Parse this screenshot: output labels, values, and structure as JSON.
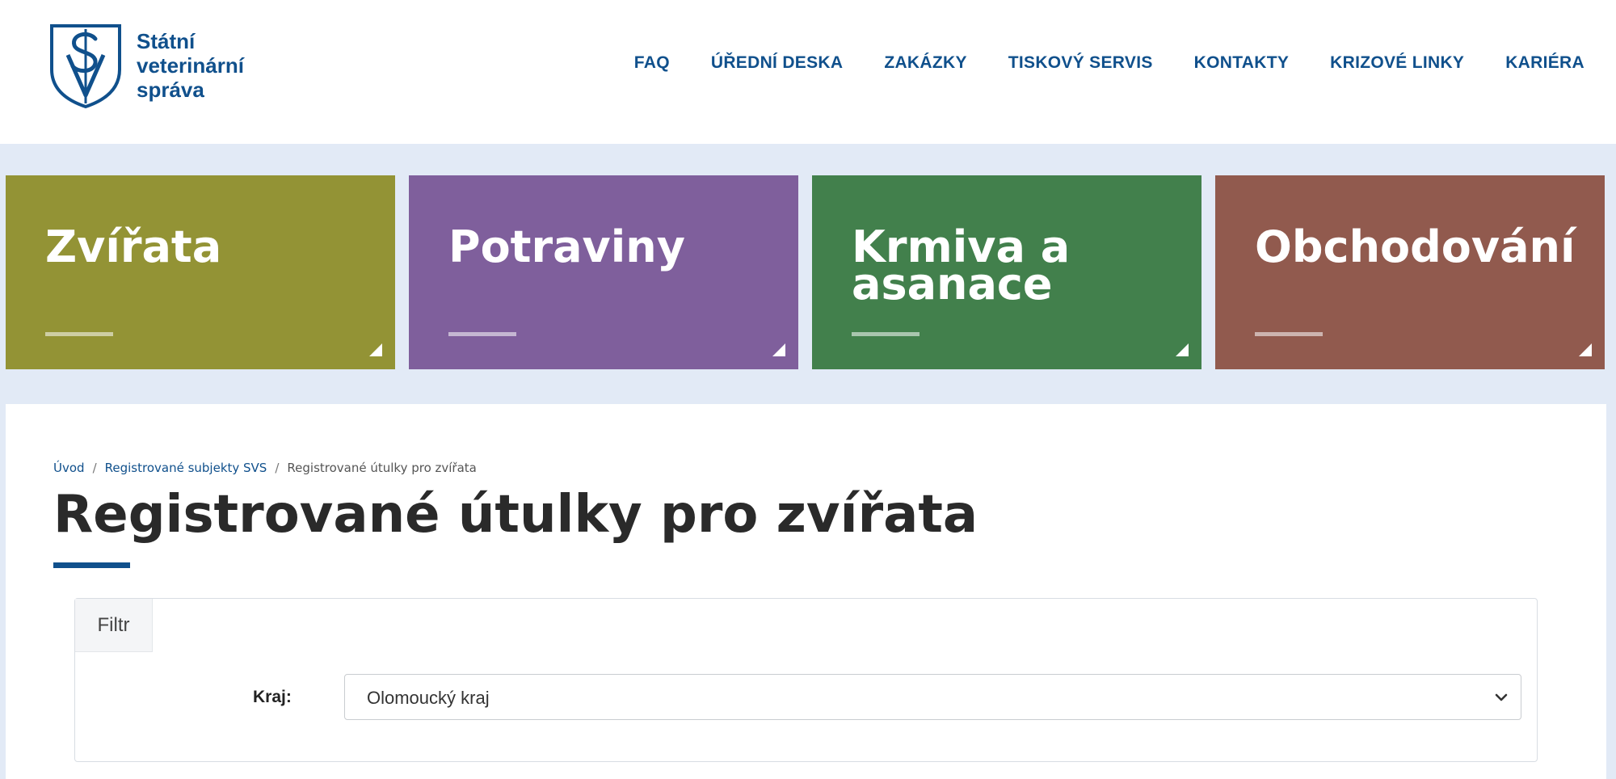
{
  "logo": {
    "line1": "Státní",
    "line2": "veterinární",
    "line3": "správa"
  },
  "topnav": [
    {
      "label": "FAQ"
    },
    {
      "label": "ÚŘEDNÍ DESKA"
    },
    {
      "label": "ZAKÁZKY"
    },
    {
      "label": "TISKOVÝ SERVIS"
    },
    {
      "label": "KONTAKTY"
    },
    {
      "label": "KRIZOVÉ LINKY"
    },
    {
      "label": "KARIÉRA"
    }
  ],
  "tiles": [
    {
      "title": "Zvířata",
      "color": "#939335"
    },
    {
      "title": "Potraviny",
      "color": "#7f5f9c"
    },
    {
      "title": "Krmiva a\nasanace",
      "color": "#42804c"
    },
    {
      "title": "Obchodování",
      "color": "#915a4e"
    }
  ],
  "breadcrumb": {
    "home": "Úvod",
    "parent": "Registrované subjekty SVS",
    "current": "Registrované útulky pro zvířata"
  },
  "page_title": "Registrované útulky pro zvířata",
  "filter": {
    "tab_label": "Filtr",
    "region_label": "Kraj:",
    "region_value": "Olomoucký kraj"
  },
  "colors": {
    "brand_blue": "#10508c",
    "page_background": "#e2eaf6"
  }
}
